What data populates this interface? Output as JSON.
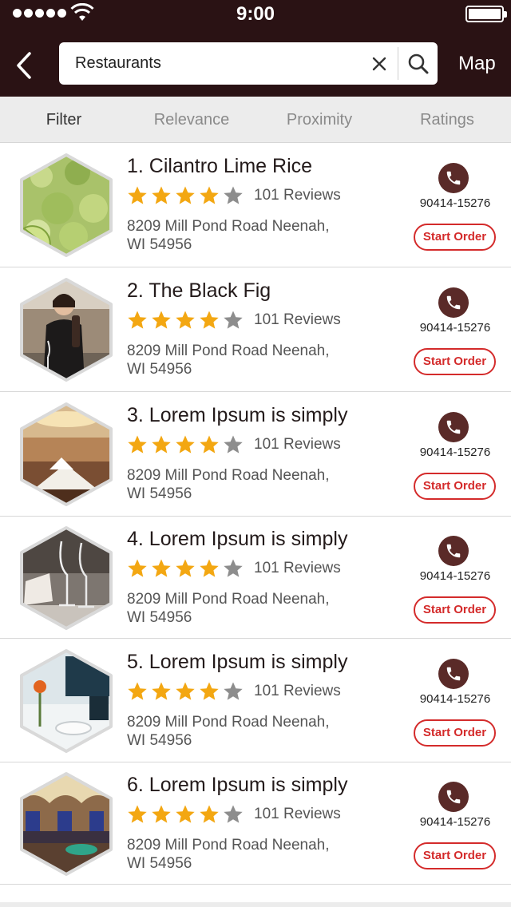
{
  "status_bar": {
    "time": "9:00"
  },
  "header": {
    "search": {
      "value": "Restaurants",
      "placeholder": "Search"
    },
    "map_label": "Map"
  },
  "filters": [
    {
      "label": "Filter",
      "active": true
    },
    {
      "label": "Relevance",
      "active": false
    },
    {
      "label": "Proximity",
      "active": false
    },
    {
      "label": "Ratings",
      "active": false
    }
  ],
  "results": [
    {
      "name": "1. Cilantro Lime Rice",
      "rating": 4,
      "max_rating": 5,
      "reviews": "101 Reviews",
      "address_line1": "8209 Mill Pond Road Neenah,",
      "address_line2": "WI 54956",
      "phone": "90414-15276",
      "order_label": "Start Order",
      "image": "rice-dish-photo"
    },
    {
      "name": "2. The Black Fig",
      "rating": 4,
      "max_rating": 5,
      "reviews": "101 Reviews",
      "address_line1": "8209 Mill Pond Road Neenah,",
      "address_line2": "WI 54956",
      "phone": "90414-15276",
      "order_label": "Start Order",
      "image": "waitress-with-wine-photo"
    },
    {
      "name": "3. Lorem Ipsum is simply",
      "rating": 4,
      "max_rating": 5,
      "reviews": "101 Reviews",
      "address_line1": "8209 Mill Pond Road Neenah,",
      "address_line2": "WI 54956",
      "phone": "90414-15276",
      "order_label": "Start Order",
      "image": "dining-room-photo"
    },
    {
      "name": "4. Lorem Ipsum is simply",
      "rating": 4,
      "max_rating": 5,
      "reviews": "101 Reviews",
      "address_line1": "8209 Mill Pond Road Neenah,",
      "address_line2": "WI 54956",
      "phone": "90414-15276",
      "order_label": "Start Order",
      "image": "wine-glasses-photo"
    },
    {
      "name": "5. Lorem Ipsum is simply",
      "rating": 4,
      "max_rating": 5,
      "reviews": "101 Reviews",
      "address_line1": "8209 Mill Pond Road Neenah,",
      "address_line2": "WI 54956",
      "phone": "90414-15276",
      "order_label": "Start Order",
      "image": "table-setting-photo"
    },
    {
      "name": "6. Lorem Ipsum is simply",
      "rating": 4,
      "max_rating": 5,
      "reviews": "101 Reviews",
      "address_line1": "8209 Mill Pond Road Neenah,",
      "address_line2": "WI 54956",
      "phone": "90414-15276",
      "order_label": "Start Order",
      "image": "lounge-interior-photo"
    }
  ],
  "colors": {
    "header_bg": "#2a1214",
    "accent_red": "#d42b2b",
    "phone_btn": "#5a2a28",
    "star_filled": "#f3a712",
    "star_empty": "#8d8d8d"
  }
}
